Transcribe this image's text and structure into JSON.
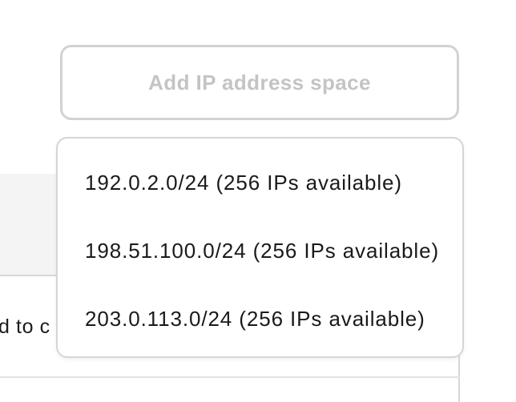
{
  "add_button": {
    "label": "Add IP address space"
  },
  "dropdown": {
    "items": [
      {
        "label": "192.0.2.0/24 (256 IPs available)"
      },
      {
        "label": "198.51.100.0/24 (256 IPs available)"
      },
      {
        "label": "203.0.113.0/24 (256 IPs available)"
      }
    ]
  },
  "background_table": {
    "row_text": "d to c"
  },
  "colors": {
    "button_border": "#d2d2d2",
    "button_text_disabled": "#c4c4c4",
    "menu_border": "#d6d6d6",
    "table_header_bg": "#f4f4f4"
  }
}
